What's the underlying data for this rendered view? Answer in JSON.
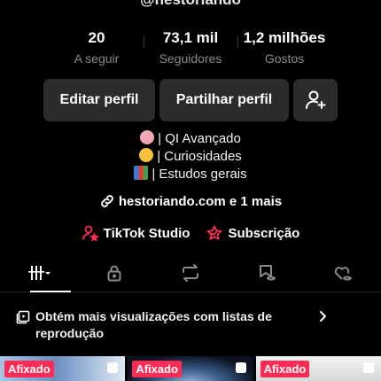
{
  "profile": {
    "handle": "@hestoriando"
  },
  "stats": [
    {
      "value": "20",
      "label": "A seguir"
    },
    {
      "value": "73,1 mil",
      "label": "Seguidores"
    },
    {
      "value": "1,2 milhões",
      "label": "Gostos"
    }
  ],
  "actions": {
    "edit_label": "Editar perfil",
    "share_label": "Partilhar perfil"
  },
  "bio": [
    {
      "emoji_icon": "brain-emoji",
      "text": "| QI Avançado"
    },
    {
      "emoji_icon": "thinking-face-emoji",
      "text": "| Curiosidades"
    },
    {
      "emoji_icon": "books-emoji",
      "text": "| Estudos gerais"
    }
  ],
  "link": {
    "text": "hestoriando.com e 1 mais"
  },
  "tools": {
    "studio_label": "TikTok Studio",
    "subscription_label": "Subscrição"
  },
  "tabs": [
    "videos-grid",
    "private",
    "reposts",
    "favorites",
    "liked"
  ],
  "banner": {
    "text": "Obtém mais visualizações com listas de reprodução"
  },
  "videos": [
    {
      "badge": "Afixado"
    },
    {
      "badge": "Afixado"
    },
    {
      "badge": "Afixado"
    }
  ],
  "colors": {
    "accent": "#fe2c55",
    "button_bg": "#2b2b2b",
    "muted_text": "#8a8a8a"
  }
}
